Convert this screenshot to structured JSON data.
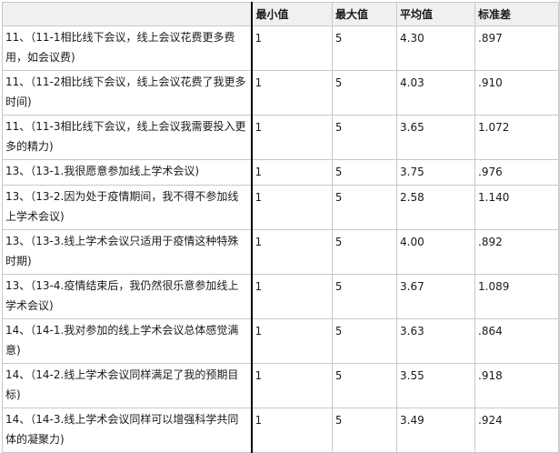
{
  "columns": {
    "item": "",
    "min": "最小值",
    "max": "最大值",
    "mean": "平均值",
    "sd": "标准差"
  },
  "rows": [
    {
      "item": "11、（11-1相比线下会议，线上会议花费更多费用，如会议费)",
      "min": "1",
      "max": "5",
      "mean": "4.30",
      "sd": ".897"
    },
    {
      "item": "11、（11-2相比线下会议，线上会议花费了我更多时间)",
      "min": "1",
      "max": "5",
      "mean": "4.03",
      "sd": ".910"
    },
    {
      "item": "11、（11-3相比线下会议，线上会议我需要投入更多的精力)",
      "min": "1",
      "max": "5",
      "mean": "3.65",
      "sd": "1.072"
    },
    {
      "item": "13、（13-1.我很愿意参加线上学术会议)",
      "min": "1",
      "max": "5",
      "mean": "3.75",
      "sd": ".976"
    },
    {
      "item": "13、（13-2.因为处于疫情期间，我不得不参加线上学术会议)",
      "min": "1",
      "max": "5",
      "mean": "2.58",
      "sd": "1.140"
    },
    {
      "item": "13、（13-3.线上学术会议只适用于疫情这种特殊时期)",
      "min": "1",
      "max": "5",
      "mean": "4.00",
      "sd": ".892"
    },
    {
      "item": "13、（13-4.疫情结束后，我仍然很乐意参加线上学术会议)",
      "min": "1",
      "max": "5",
      "mean": "3.67",
      "sd": "1.089"
    },
    {
      "item": "14、（14-1.我对参加的线上学术会议总体感觉满意)",
      "min": "1",
      "max": "5",
      "mean": "3.63",
      "sd": ".864"
    },
    {
      "item": "14、（14-2.线上学术会议同样满足了我的预期目标)",
      "min": "1",
      "max": "5",
      "mean": "3.55",
      "sd": ".918"
    },
    {
      "item": "14、（14-3.线上学术会议同样可以增强科学共同体的凝聚力)",
      "min": "1",
      "max": "5",
      "mean": "3.49",
      "sd": ".924"
    }
  ]
}
